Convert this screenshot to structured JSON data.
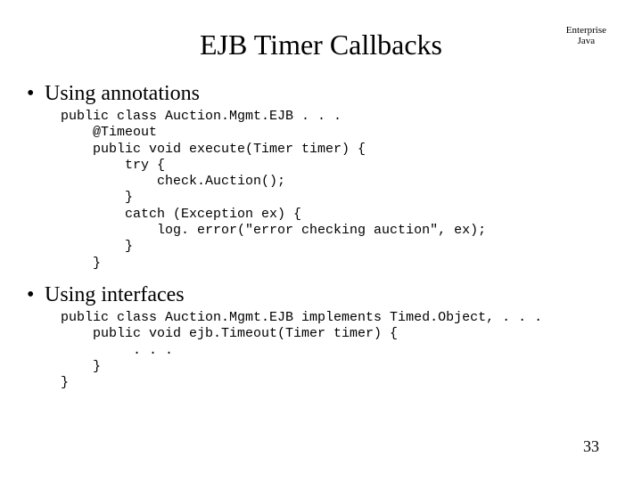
{
  "title": "EJB Timer Callbacks",
  "corner_top": "Enterprise",
  "corner_bot": "Java",
  "bullet1": "Using annotations",
  "code1": "public class Auction.Mgmt.EJB . . .\n    @Timeout\n    public void execute(Timer timer) {\n        try {\n            check.Auction();\n        }\n        catch (Exception ex) {\n            log. error(\"error checking auction\", ex);\n        }\n    }",
  "bullet2": "Using interfaces",
  "code2": "public class Auction.Mgmt.EJB implements Timed.Object, . . .\n    public void ejb.Timeout(Timer timer) {\n         . . .\n    }\n}",
  "pagenum": "33"
}
